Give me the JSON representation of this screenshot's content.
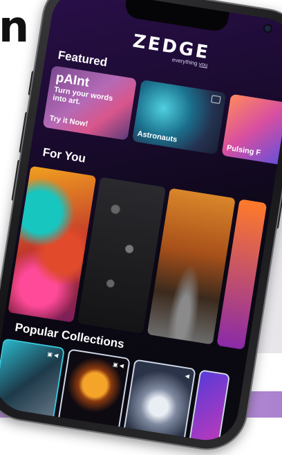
{
  "background": {
    "letter": "n"
  },
  "app": {
    "logo": "ZEDGE",
    "tagline_prefix": "everything ",
    "tagline_emph": "you"
  },
  "featured": {
    "title": "Featured",
    "cards": [
      {
        "title": "pAInt",
        "subtitle": "Turn your words into art.",
        "cta": "Try it Now!"
      },
      {
        "label": "Astronauts"
      },
      {
        "label": "Pulsing F"
      }
    ]
  },
  "for_you": {
    "title": "For You"
  },
  "popular": {
    "title": "Popular Collections"
  },
  "icons": [
    "image-icon",
    "sound-icon"
  ],
  "colors": {
    "screen_bg": "#170a2a",
    "accent": "#b46ab6"
  }
}
